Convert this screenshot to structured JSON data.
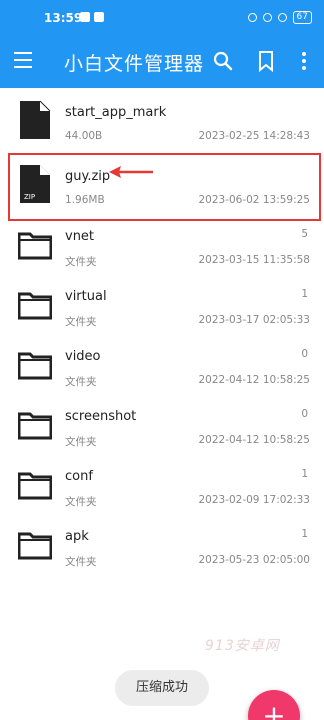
{
  "statusbar": {
    "time": "13:59",
    "battery": "67"
  },
  "appbar": {
    "title": "小白文件管理器",
    "icons": [
      "menu-icon",
      "search-icon",
      "bookmark-icon",
      "more-vert-icon"
    ]
  },
  "files": [
    {
      "name": "start_app_mark",
      "sub": "44.00B",
      "count": "",
      "date": "2023-02-25 14:28:43",
      "type": "file"
    },
    {
      "name": "guy.zip",
      "sub": "1.96MB",
      "count": "",
      "date": "2023-06-02 13:59:25",
      "type": "zip",
      "badge": "ZIP"
    },
    {
      "name": "vnet",
      "sub": "文件夹",
      "count": "5",
      "date": "2023-03-15 11:35:58",
      "type": "folder"
    },
    {
      "name": "virtual",
      "sub": "文件夹",
      "count": "1",
      "date": "2023-03-17 02:05:33",
      "type": "folder"
    },
    {
      "name": "video",
      "sub": "文件夹",
      "count": "0",
      "date": "2022-04-12 10:58:25",
      "type": "folder"
    },
    {
      "name": "screenshot",
      "sub": "文件夹",
      "count": "0",
      "date": "2022-04-12 10:58:25",
      "type": "folder"
    },
    {
      "name": "conf",
      "sub": "文件夹",
      "count": "1",
      "date": "2023-02-09 17:02:33",
      "type": "folder"
    },
    {
      "name": "apk",
      "sub": "文件夹",
      "count": "1",
      "date": "2023-05-23 02:05:00",
      "type": "folder"
    }
  ],
  "watermark": "913安卓网",
  "toast": "压缩成功",
  "fab": "+",
  "colors": {
    "primary": "#2196f3",
    "highlight": "#e53935",
    "fab": "#f0386b"
  }
}
